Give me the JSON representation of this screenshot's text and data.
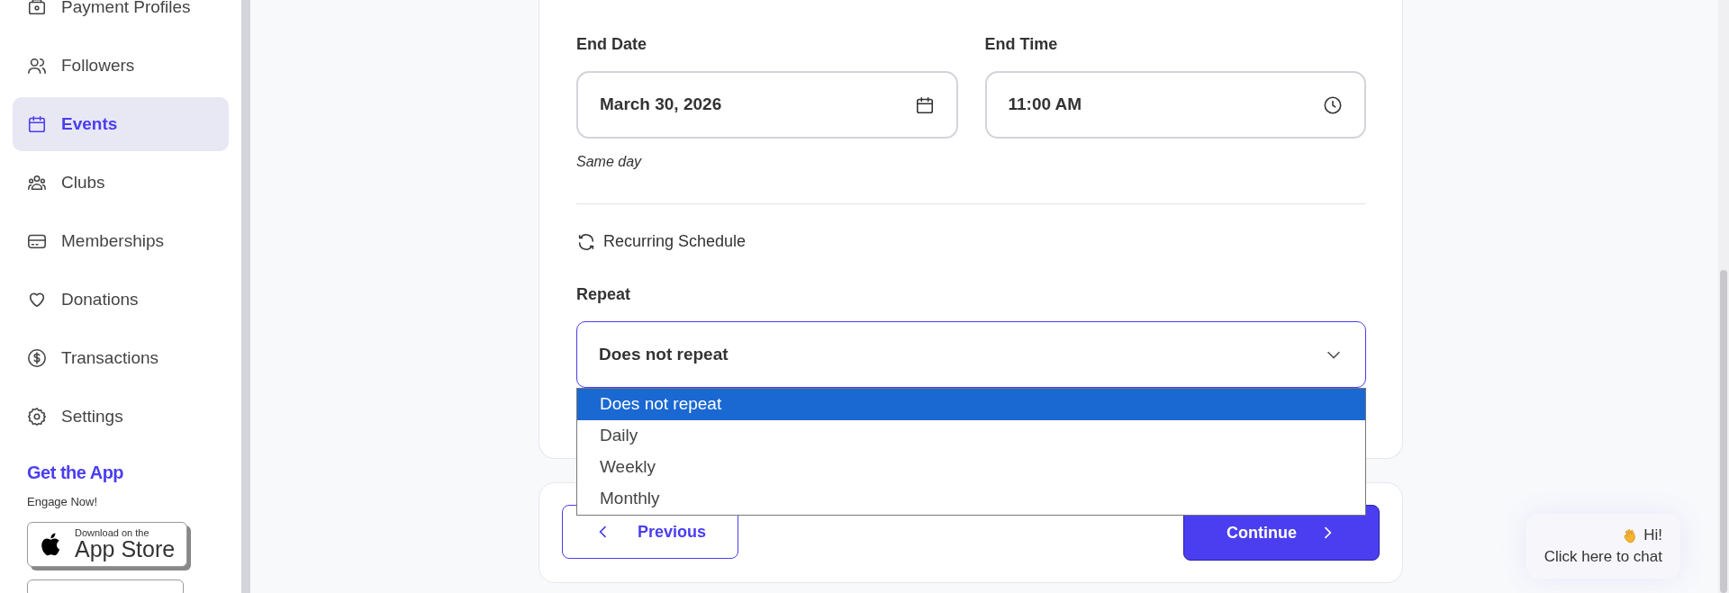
{
  "sidebar": {
    "items": [
      {
        "label": "Payment Profiles",
        "selected": false
      },
      {
        "label": "Followers",
        "selected": false
      },
      {
        "label": "Events",
        "selected": true
      },
      {
        "label": "Clubs",
        "selected": false
      },
      {
        "label": "Memberships",
        "selected": false
      },
      {
        "label": "Donations",
        "selected": false
      },
      {
        "label": "Transactions",
        "selected": false
      },
      {
        "label": "Settings",
        "selected": false
      }
    ],
    "promo": {
      "title": "Get the App",
      "subtitle": "Engage Now!",
      "badge_small": "Download on the",
      "badge_large": "App Store"
    }
  },
  "form": {
    "end_date": {
      "label": "End Date",
      "value": "March 30, 2026",
      "hint": "Same day"
    },
    "end_time": {
      "label": "End Time",
      "value": "11:00 AM"
    },
    "section_title": "Recurring Schedule",
    "repeat": {
      "label": "Repeat",
      "value": "Does not repeat",
      "expanded": true,
      "options": [
        {
          "label": "Does not repeat",
          "selected": true
        },
        {
          "label": "Daily",
          "selected": false
        },
        {
          "label": "Weekly",
          "selected": false
        },
        {
          "label": "Monthly",
          "selected": false
        }
      ]
    }
  },
  "footer": {
    "previous": "Previous",
    "continue": "Continue"
  },
  "chat": {
    "line1": "Hi!",
    "line2": "Click here to chat"
  }
}
